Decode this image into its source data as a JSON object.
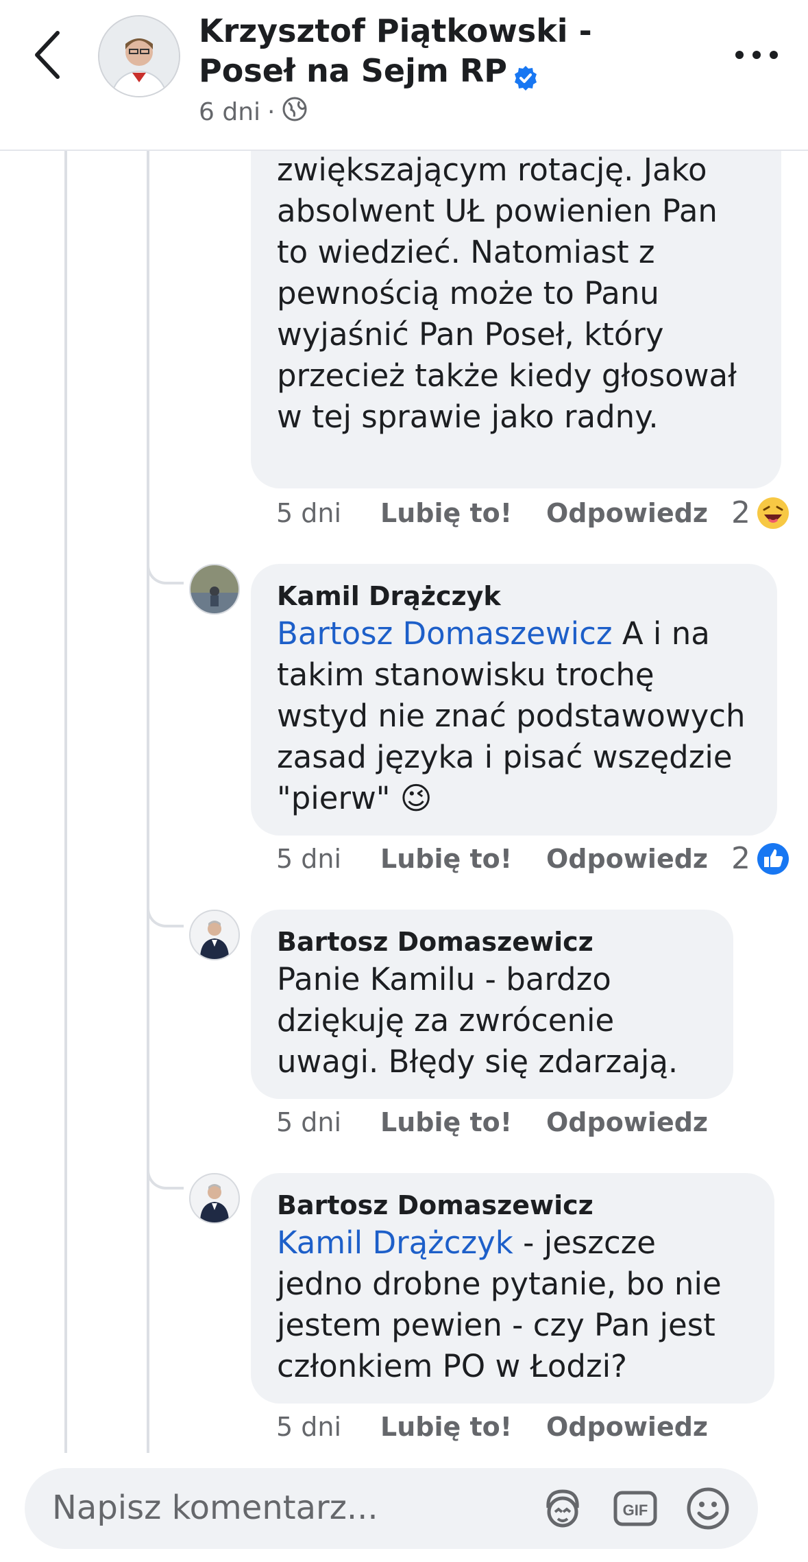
{
  "header": {
    "title": "Krzysztof Piątkowski - Poseł na Sejm RP",
    "time": "6 dni",
    "separator": "·"
  },
  "comments": [
    {
      "author": "",
      "text": "zwiększającym rotację. Jako absolwent UŁ powienien Pan to wiedzieć. Natomiast z pewnością może to Panu wyjaśnić Pan Poseł, który przecież także kiedy głosował w tej sprawie jako radny.",
      "time": "5 dni",
      "like": "Lubię to!",
      "reply": "Odpowiedz",
      "reaction_count": "2",
      "reaction_icon": "laughing-emoji"
    },
    {
      "author": "Kamil Drążczyk",
      "mention": "Bartosz Domaszewicz",
      "text": " A i na takim stanowisku trochę wstyd nie znać podstawowych zasad języka i pisać wszędzie \"pierw\" 😉",
      "time": "5 dni",
      "like": "Lubię to!",
      "reply": "Odpowiedz",
      "reaction_count": "2",
      "reaction_icon": "like-thumb"
    },
    {
      "author": "Bartosz Domaszewicz",
      "text": "Panie Kamilu - bardzo dziękuję za zwrócenie uwagi. Błędy się zdarzają.",
      "time": "5 dni",
      "like": "Lubię to!",
      "reply": "Odpowiedz"
    },
    {
      "author": "Bartosz Domaszewicz",
      "mention": "Kamil Drążczyk",
      "text": " - jeszcze jedno drobne pytanie, bo nie jestem pewien - czy Pan jest członkiem PO w Łodzi?",
      "time": "5 dni",
      "like": "Lubię to!",
      "reply": "Odpowiedz"
    }
  ],
  "footer": {
    "placeholder": "Napisz komentarz...",
    "gif_label": "GIF"
  },
  "colors": {
    "mention": "#1d5fc9",
    "bubble": "#f0f2f5",
    "verified": "#1877f2",
    "like": "#1877f2"
  }
}
